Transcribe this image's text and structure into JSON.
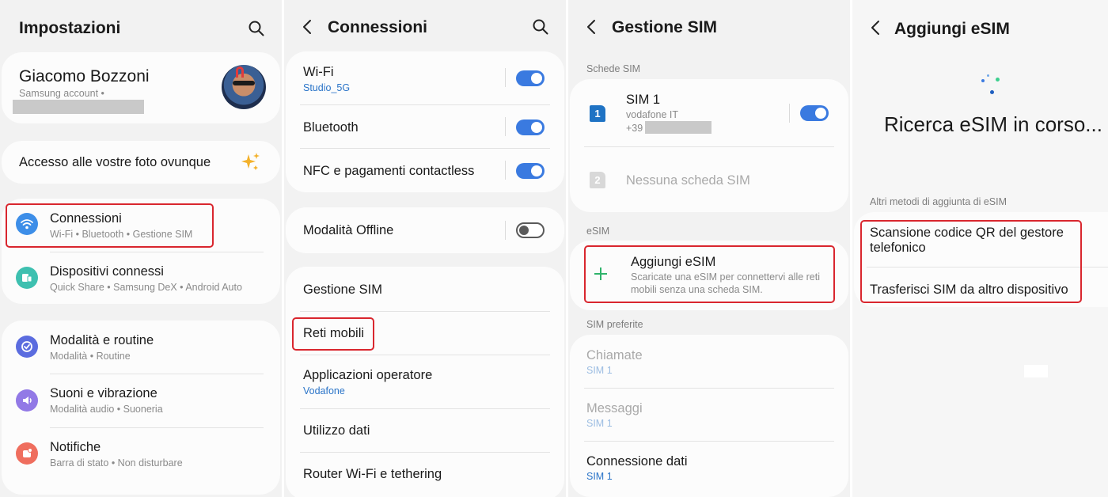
{
  "colors": {
    "accent_blue": "#3a7ae0",
    "highlight_red": "#d9262e",
    "add_green": "#2fb36b",
    "panel_bg": "#f2f2f2"
  },
  "settings": {
    "title": "Impostazioni",
    "profile": {
      "name": "Giacomo Bozzoni",
      "account": "Samsung account •"
    },
    "promo": "Accesso alle vostre foto ovunque",
    "items": [
      {
        "label": "Connessioni",
        "sub": "Wi-Fi  •  Bluetooth  •  Gestione SIM",
        "icon": "wifi-icon"
      },
      {
        "label": "Dispositivi connessi",
        "sub": "Quick Share  •  Samsung DeX  •  Android Auto",
        "icon": "devices-icon"
      },
      {
        "label": "Modalità e routine",
        "sub": "Modalità  •  Routine",
        "icon": "check-circle-icon"
      },
      {
        "label": "Suoni e vibrazione",
        "sub": "Modalità audio  •  Suoneria",
        "icon": "speaker-icon"
      },
      {
        "label": "Notifiche",
        "sub": "Barra di stato  •  Non disturbare",
        "icon": "bell-icon"
      }
    ]
  },
  "connections": {
    "title": "Connessioni",
    "wifi": {
      "label": "Wi-Fi",
      "network": "Studio_5G",
      "on": true
    },
    "bluetooth": {
      "label": "Bluetooth",
      "on": true
    },
    "nfc": {
      "label": "NFC e pagamenti contactless",
      "on": true
    },
    "offline": {
      "label": "Modalità Offline",
      "on": false
    },
    "items": [
      {
        "label": "Gestione SIM"
      },
      {
        "label": "Reti mobili"
      },
      {
        "label": "Applicazioni operatore",
        "sub": "Vodafone"
      },
      {
        "label": "Utilizzo dati"
      },
      {
        "label": "Router Wi-Fi e tethering"
      }
    ]
  },
  "sim": {
    "title": "Gestione SIM",
    "cards_label": "Schede SIM",
    "sim1": {
      "badge": "1",
      "name": "SIM 1",
      "carrier": "vodafone IT",
      "number": "+39",
      "on": true
    },
    "sim2": {
      "badge": "2",
      "name": "Nessuna scheda SIM"
    },
    "esim_label": "eSIM",
    "add_esim": {
      "title": "Aggiungi eSIM",
      "desc_line1": "Scaricate una eSIM per connettervi alle reti",
      "desc_line2": "mobili senza una scheda SIM."
    },
    "preferred_label": "SIM preferite",
    "preferred": [
      {
        "label": "Chiamate",
        "value": "SIM 1"
      },
      {
        "label": "Messaggi",
        "value": "SIM 1"
      },
      {
        "label": "Connessione dati",
        "value": "SIM 1"
      }
    ]
  },
  "add_esim_screen": {
    "title": "Aggiungi eSIM",
    "searching": "Ricerca eSIM in corso...",
    "other_methods_label": "Altri metodi di aggiunta di eSIM",
    "methods": [
      {
        "line1": "Scansione codice QR del gestore",
        "line2": "telefonico"
      },
      {
        "line1": "Trasferisci SIM da altro dispositivo"
      }
    ]
  }
}
